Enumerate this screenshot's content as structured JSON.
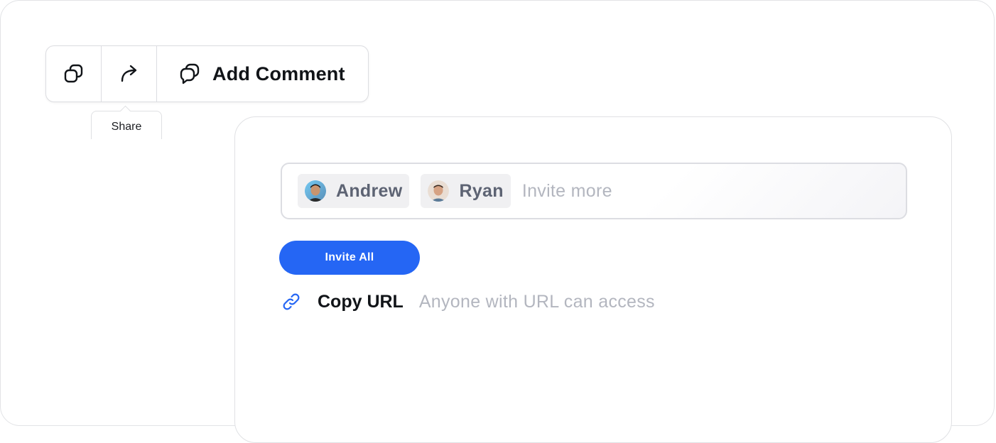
{
  "toolbar": {
    "duplicate_icon": "duplicate-icon",
    "share_icon": "share-arrow-icon",
    "comment_icon": "comment-icon",
    "add_comment_label": "Add Comment"
  },
  "tooltip": {
    "text": "Share"
  },
  "share_panel": {
    "invitees": [
      {
        "name": "Andrew"
      },
      {
        "name": "Ryan"
      }
    ],
    "invite_placeholder": "Invite more",
    "invite_all_label": "Invite All",
    "copy_url_label": "Copy URL",
    "copy_url_hint": "Anyone with URL can access"
  },
  "colors": {
    "accent": "#2566f4",
    "text_primary": "#111418",
    "text_muted": "#b3b6bf",
    "chip_bg": "#f0f0f2",
    "border": "#dcdde1"
  }
}
